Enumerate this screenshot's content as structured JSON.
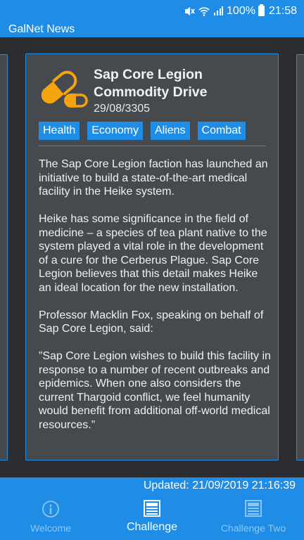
{
  "status_bar": {
    "battery": "100%",
    "time": "21:58"
  },
  "app_bar": {
    "title": "GalNet News"
  },
  "article": {
    "title": "Sap Core Legion Commodity Drive",
    "date": "29/08/3305",
    "tags": [
      "Health",
      "Economy",
      "Aliens",
      "Combat"
    ],
    "paragraphs": [
      "The Sap Core Legion faction has launched an initiative to build a state-of-the-art medical facility in the Heike system.",
      "Heike has some significance in the field of medicine – a species of tea plant native to the system played a vital role in the development of a cure for the Cerberus Plague. Sap Core Legion believes that this detail makes Heike an ideal location for the new installation.",
      "Professor Macklin Fox, speaking on behalf of Sap Core Legion, said:",
      "”Sap Core Legion wishes to build this facility in response to a number of recent outbreaks and epidemics. When one also considers the current Thargoid conflict, we feel humanity would benefit from additional off-world medical resources.”"
    ],
    "icon": "capsule-pills-icon"
  },
  "footer": {
    "updated": "Updated: 21/09/2019 21:16:39"
  },
  "nav": {
    "items": [
      {
        "label": "Welcome",
        "icon": "info-icon",
        "active": false
      },
      {
        "label": "Challenge",
        "icon": "newspaper-icon",
        "active": true
      },
      {
        "label": "Challenge Two",
        "icon": "newspaper-icon",
        "active": false
      }
    ]
  },
  "colors": {
    "accent": "#1f8de6",
    "card": "#46494d",
    "background": "#2b2d30",
    "pill": "#f5a30e"
  }
}
